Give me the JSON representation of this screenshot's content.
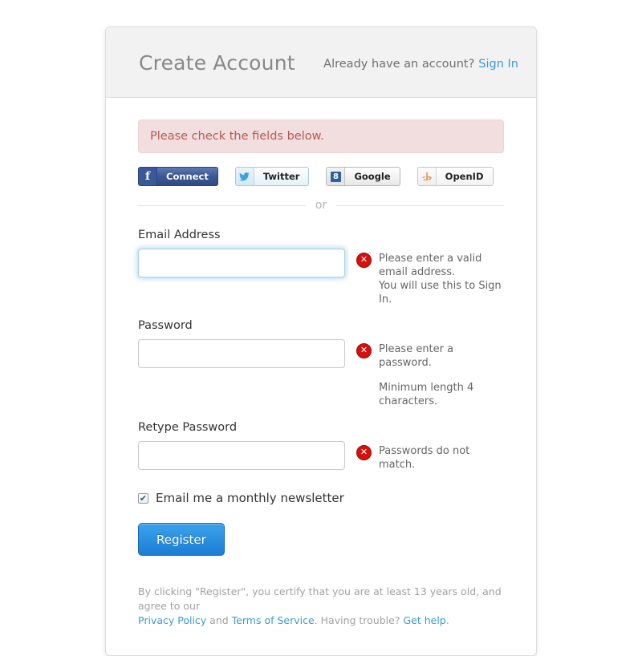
{
  "header": {
    "title": "Create Account",
    "account_prompt": "Already have an account?",
    "signin_label": "Sign In"
  },
  "alert": {
    "message": "Please check the fields below."
  },
  "social": {
    "buttons": [
      {
        "icon": "facebook-icon",
        "glyph": "f",
        "label": "Connect"
      },
      {
        "icon": "twitter-icon",
        "glyph": "ᴠ",
        "label": "Twitter"
      },
      {
        "icon": "google-icon",
        "glyph": "8",
        "label": "Google"
      },
      {
        "icon": "openid-icon",
        "glyph": "ɖ",
        "label": "OpenID"
      }
    ]
  },
  "divider": {
    "text": "or"
  },
  "form": {
    "email": {
      "label": "Email Address",
      "value": "",
      "placeholder": "",
      "focused": true,
      "error": "Please enter a valid email address.",
      "hint": "You will use this to Sign In."
    },
    "password": {
      "label": "Password",
      "value": "",
      "placeholder": "",
      "error": "Please enter a password.",
      "hint": "Minimum length 4 characters."
    },
    "retype_password": {
      "label": "Retype Password",
      "value": "",
      "placeholder": "",
      "error": "Passwords do not match.",
      "hint": ""
    },
    "newsletter": {
      "label": "Email me a monthly newsletter",
      "checked": true,
      "check_glyph": "✔"
    },
    "submit_label": "Register"
  },
  "footer": {
    "line1_prefix": "By clicking \"Register\", you certify that you are at least 13 years old, and agree to our",
    "privacy_link": "Privacy Policy",
    "and_text": "and",
    "terms_link": "Terms of Service",
    "trouble_text": ". Having trouble?",
    "help_link": "Get help",
    "period": "."
  },
  "colors": {
    "link": "#3a9bd5",
    "alert_bg": "#f2dede",
    "alert_text": "#b55a55",
    "error_icon": "#d5110e",
    "primary_button": "#1b7dd4"
  }
}
